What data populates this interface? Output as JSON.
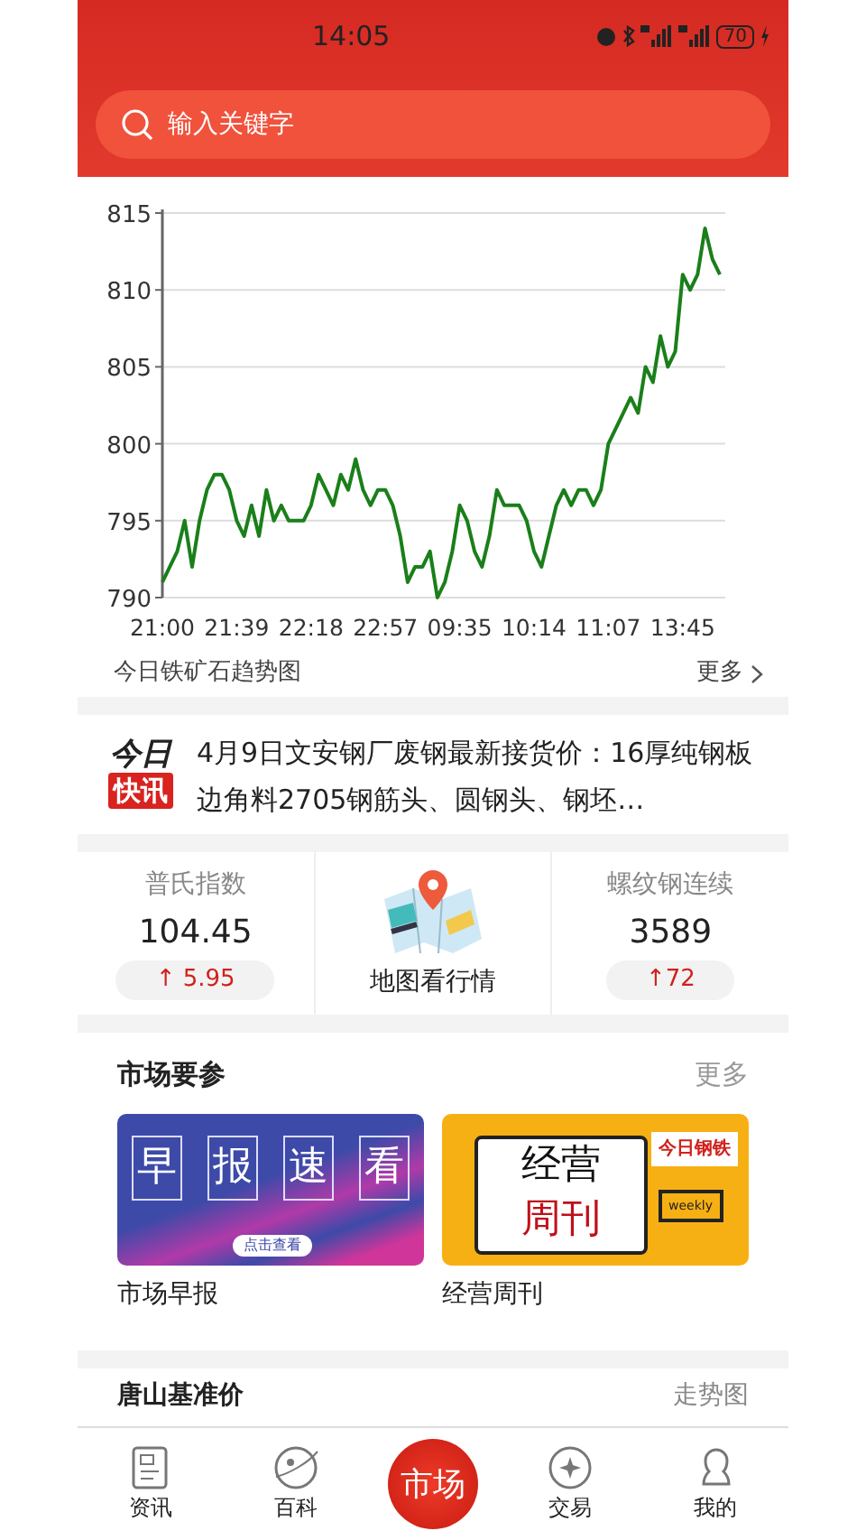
{
  "status_bar": {
    "time": "14:05",
    "battery": "70"
  },
  "search": {
    "placeholder": "输入关键字"
  },
  "chart_panel": {
    "chart_data": {
      "type": "line",
      "categories": [
        "21:00",
        null,
        null,
        null,
        null,
        null,
        null,
        null,
        null,
        null,
        "21:39",
        null,
        null,
        null,
        null,
        null,
        null,
        null,
        null,
        null,
        "22:18",
        null,
        null,
        null,
        null,
        null,
        null,
        null,
        null,
        null,
        "22:57",
        null,
        null,
        null,
        null,
        null,
        null,
        null,
        null,
        null,
        "09:35",
        null,
        null,
        null,
        null,
        null,
        null,
        null,
        null,
        null,
        "10:14",
        null,
        null,
        null,
        null,
        null,
        null,
        null,
        null,
        null,
        "11:07",
        null,
        null,
        null,
        null,
        null,
        null,
        null,
        null,
        null,
        "13:45",
        null,
        null,
        null,
        null,
        null
      ],
      "series": [
        {
          "color": "#1a7f1a",
          "values": [
            791,
            792,
            793,
            795,
            792,
            795,
            797,
            798,
            798,
            797,
            795,
            794,
            796,
            794,
            797,
            795,
            796,
            795,
            795,
            795,
            796,
            798,
            797,
            796,
            798,
            797,
            799,
            797,
            796,
            797,
            797,
            796,
            794,
            791,
            792,
            792,
            793,
            790,
            791,
            793,
            796,
            795,
            793,
            792,
            794,
            797,
            796,
            796,
            796,
            795,
            793,
            792,
            794,
            796,
            797,
            796,
            797,
            797,
            796,
            797,
            800,
            801,
            802,
            803,
            802,
            805,
            804,
            807,
            805,
            806,
            811,
            810,
            811,
            814,
            812,
            811
          ]
        }
      ],
      "ylim": [
        790,
        815
      ],
      "grid": true,
      "yticks": [
        790,
        795,
        800,
        805,
        810,
        815
      ]
    },
    "caption": "今日铁矿石趋势图",
    "more": "更多"
  },
  "flash_news": {
    "badge_top": "今日",
    "badge_bottom": "快讯",
    "text": "4月9日文安钢厂废钢最新接货价：16厚纯钢板边角料2705钢筋头、圆钢头、钢坯…"
  },
  "quotes": [
    {
      "kind": "index",
      "label": "普氏指数",
      "value": "104.45",
      "change": "↑ 5.95"
    },
    {
      "kind": "map",
      "label": "地图看行情"
    },
    {
      "kind": "index",
      "label": "螺纹钢连续",
      "value": "3589",
      "change": "↑72"
    }
  ],
  "market_section": {
    "title": "市场要参",
    "more": "更多",
    "cards": [
      {
        "kind": "morning",
        "caption": "市场早报",
        "banner_chars": [
          "早",
          "报",
          "速",
          "看"
        ],
        "banner_button": "点击查看"
      },
      {
        "kind": "weekly",
        "caption": "经营周刊",
        "banner_lines": [
          "经营",
          "周刊"
        ],
        "banner_tag": "今日钢铁",
        "banner_screen": "weekly"
      }
    ]
  },
  "price_row": {
    "title": "唐山基准价",
    "link": "走势图"
  },
  "bottom_nav": [
    {
      "kind": "news",
      "label": "资讯",
      "selected": false
    },
    {
      "kind": "wiki",
      "label": "百科",
      "selected": false
    },
    {
      "kind": "market",
      "label": "市场",
      "selected": true
    },
    {
      "kind": "trade",
      "label": "交易",
      "selected": false
    },
    {
      "kind": "me",
      "label": "我的",
      "selected": false
    }
  ]
}
